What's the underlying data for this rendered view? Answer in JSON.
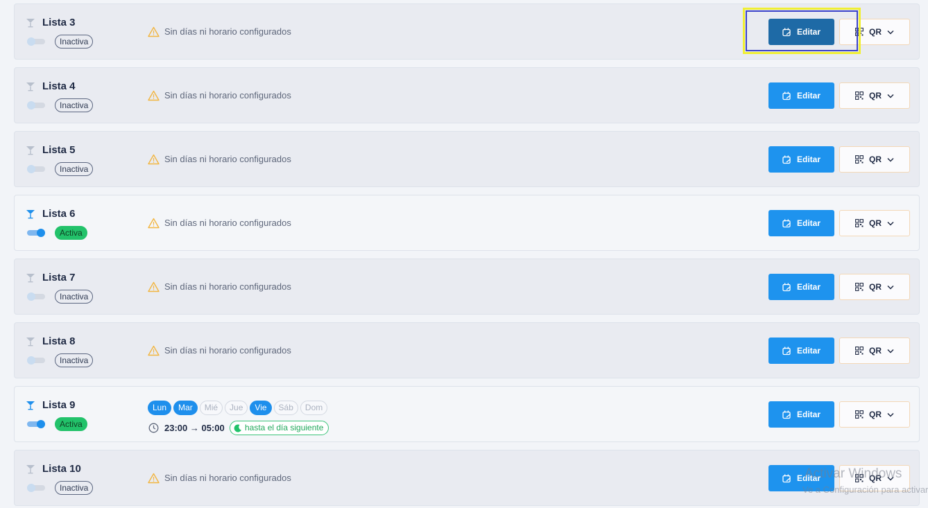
{
  "warning_text": "Sin días ni horario configurados",
  "edit_label": "Editar",
  "qr_label": "QR",
  "colors": {
    "primary": "#1e93ee",
    "primary_pressed": "#1e6aa6",
    "active_green": "#22c26a",
    "warning": "#f2b540",
    "focus_yellow": "#f0ef34",
    "focus_blue": "#3b43c9"
  },
  "lists": [
    {
      "name": "Lista 3",
      "status": "Inactiva",
      "active": false
    },
    {
      "name": "Lista 4",
      "status": "Inactiva",
      "active": false
    },
    {
      "name": "Lista 5",
      "status": "Inactiva",
      "active": false
    },
    {
      "name": "Lista 6",
      "status": "Activa",
      "active": true
    },
    {
      "name": "Lista 7",
      "status": "Inactiva",
      "active": false
    },
    {
      "name": "Lista 8",
      "status": "Inactiva",
      "active": false
    },
    {
      "name": "Lista 9",
      "status": "Activa",
      "active": true,
      "days": [
        {
          "label": "Lun",
          "on": true
        },
        {
          "label": "Mar",
          "on": true
        },
        {
          "label": "Mié",
          "on": false
        },
        {
          "label": "Jue",
          "on": false
        },
        {
          "label": "Vie",
          "on": true
        },
        {
          "label": "Sáb",
          "on": false
        },
        {
          "label": "Dom",
          "on": false
        }
      ],
      "time": "23:00 → 05:00",
      "next_day": "hasta el día siguiente"
    },
    {
      "name": "Lista 10",
      "status": "Inactiva",
      "active": false
    }
  ],
  "watermark": {
    "title": "Activar Windows",
    "subtitle": "Ve a Configuración para activar Windows."
  }
}
